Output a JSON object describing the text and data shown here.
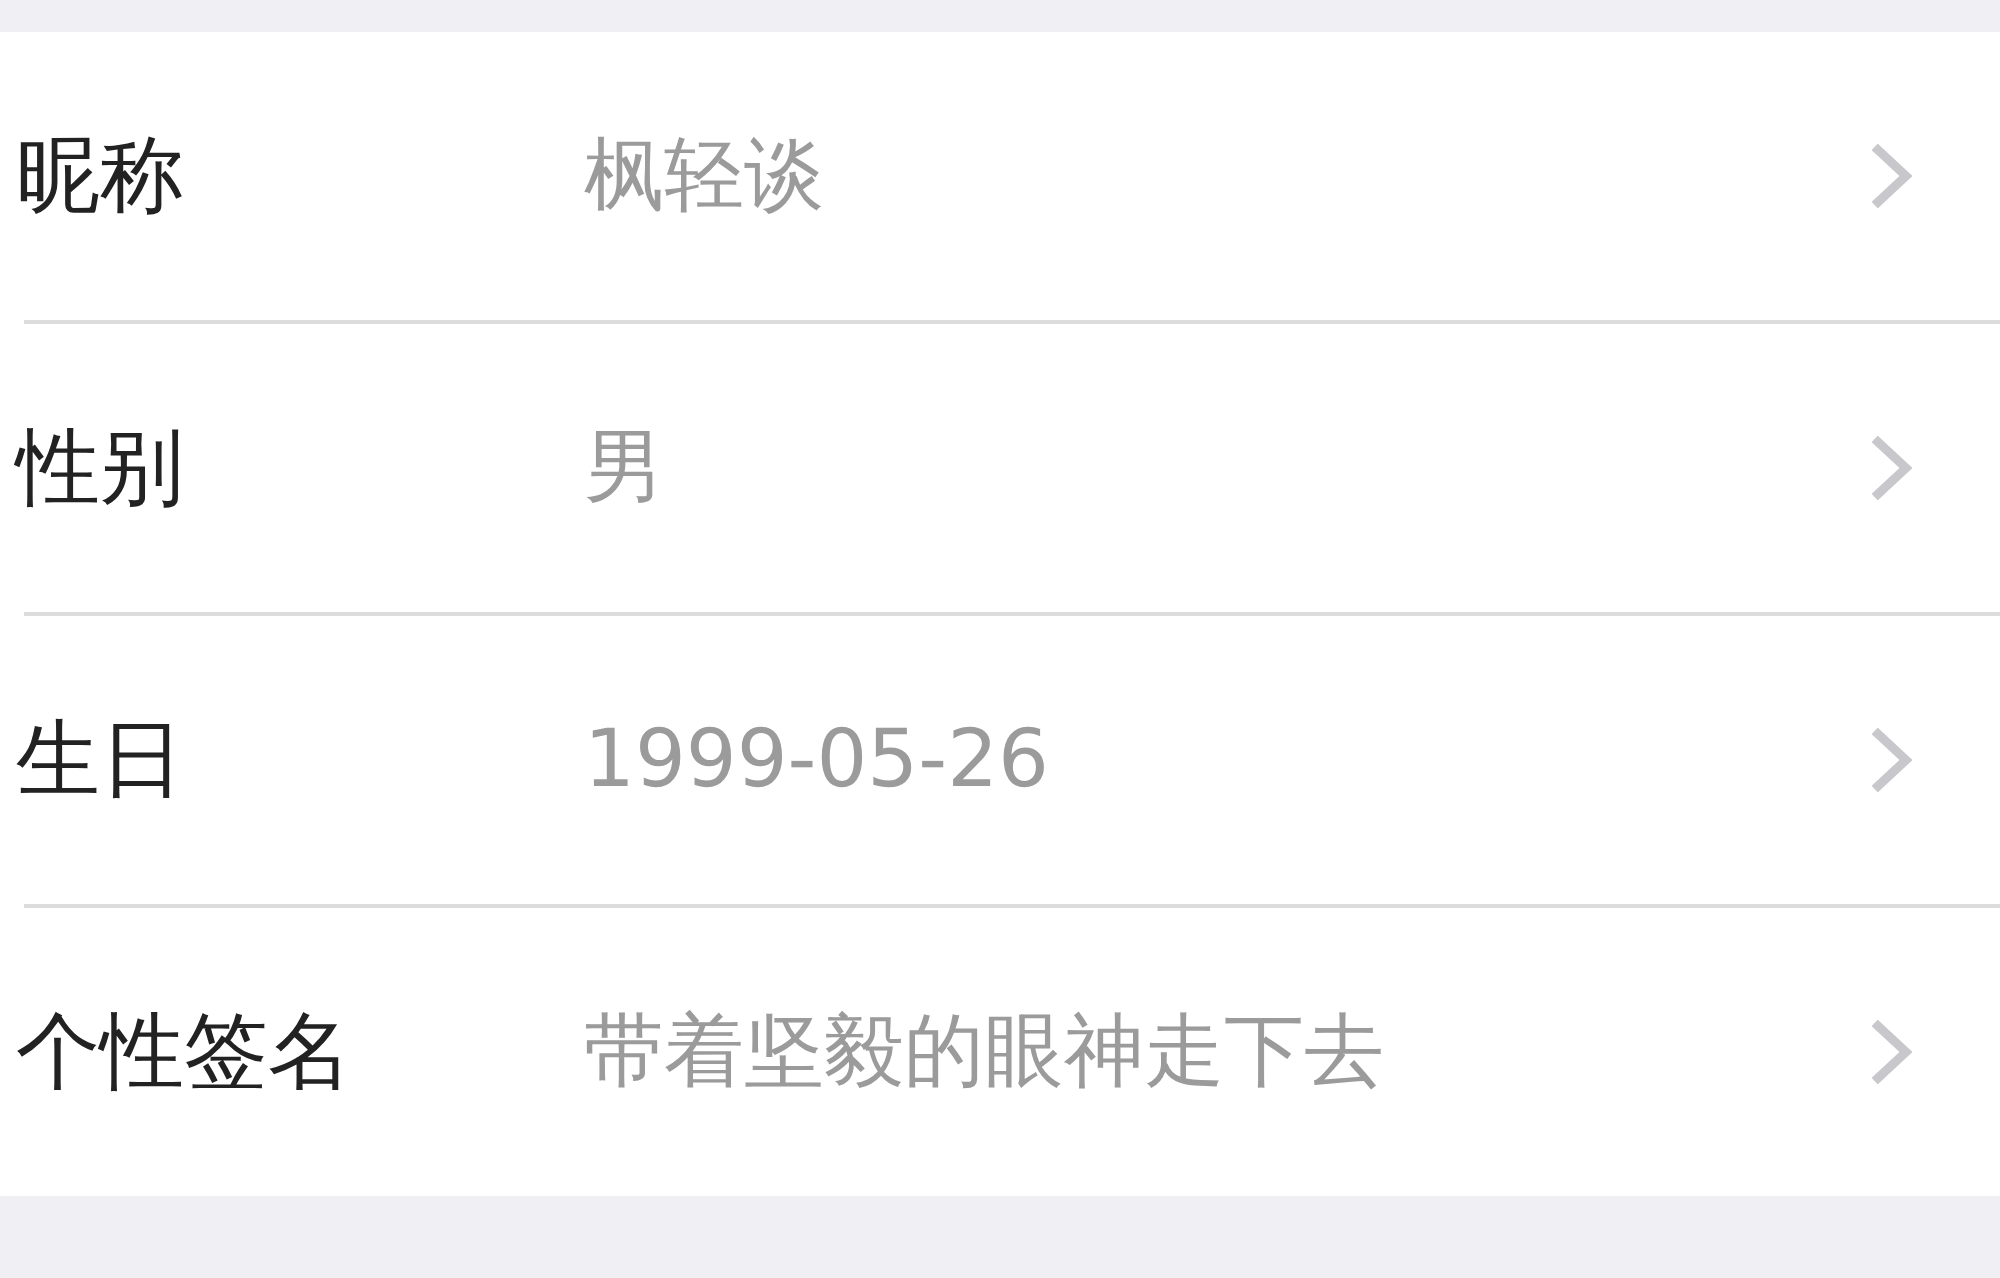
{
  "rows": [
    {
      "label": "昵称",
      "value": "枫轻谈"
    },
    {
      "label": "性别",
      "value": "男"
    },
    {
      "label": "生日",
      "value": "1999-05-26"
    },
    {
      "label": "个性签名",
      "value": "带着坚毅的眼神走下去"
    }
  ]
}
